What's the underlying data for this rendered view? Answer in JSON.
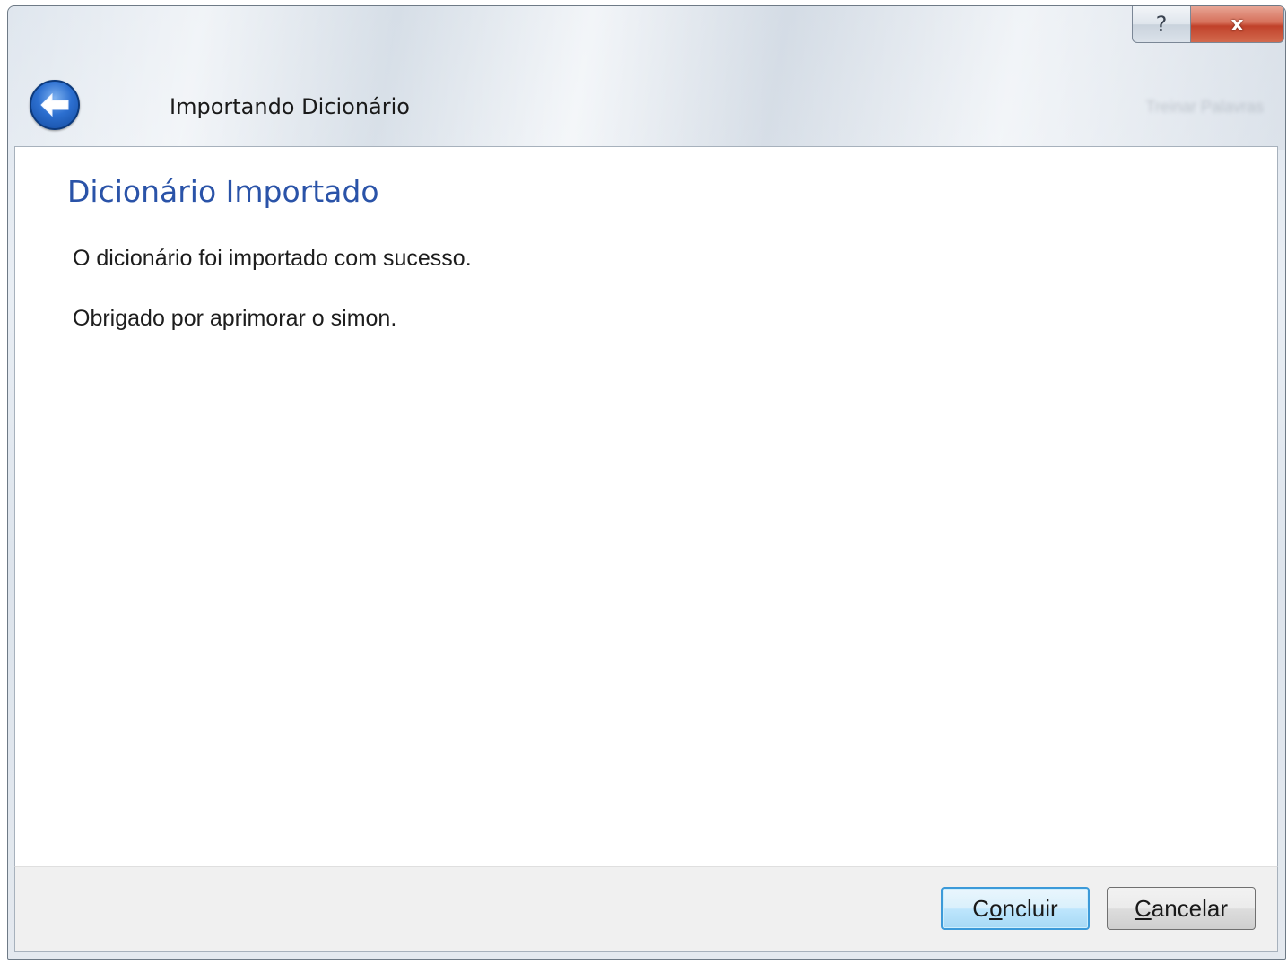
{
  "window": {
    "caption_buttons": {
      "help_label": "?",
      "close_label": "x"
    }
  },
  "header": {
    "title": "Importando Dicionário",
    "ghost_label": "Treinar Palavras"
  },
  "page": {
    "heading": "Dicionário Importado",
    "messages": [
      "O dicionário foi importado com sucesso.",
      "Obrigado por aprimorar o simon."
    ]
  },
  "footer": {
    "finish_button": {
      "pre": "C",
      "mnemonic": "o",
      "post": "ncluir"
    },
    "cancel_button": {
      "pre": "",
      "mnemonic": "C",
      "post": "ancelar"
    }
  },
  "colors": {
    "heading": "#2a53a8",
    "primary_button_border": "#3c9ad9",
    "close_button": "#c0412a"
  }
}
